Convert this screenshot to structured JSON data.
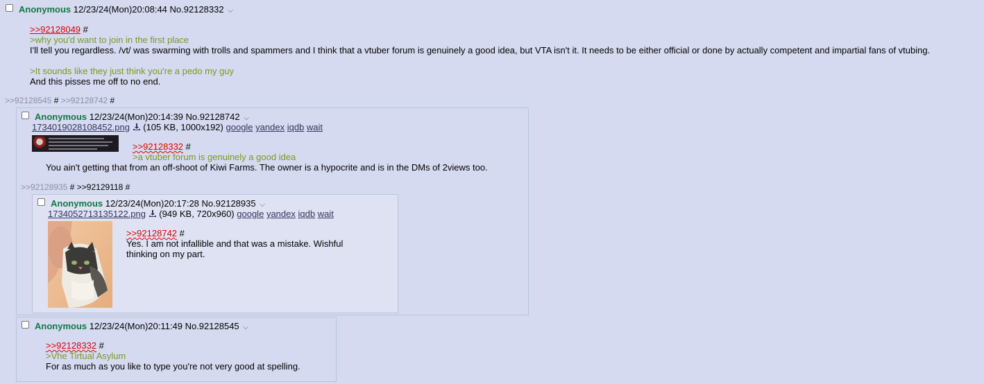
{
  "op": {
    "name": "Anonymous",
    "date": "12/23/24(Mon)20:08:44",
    "no": "No.92128332",
    "quote_link": ">>92128049",
    "greentext1": ">why you'd want to join in the first place",
    "text1": "I'll tell you regardless. /vt/ was swarming with trolls and spammers and I think that a vtuber forum is genuinely a good idea, but VTA isn't it. It needs to be either official or done by actually competent and impartial fans of vtubing.",
    "greentext2": ">It sounds like they just think you're a pedo my guy",
    "text2": "And this pisses me off to no end.",
    "backlinks": [
      ">>92128545",
      ">>92128742"
    ]
  },
  "reply1": {
    "name": "Anonymous",
    "date": "12/23/24(Mon)20:14:39",
    "no": "No.92128742",
    "filename": "1734019028108452.png",
    "fileinfo": "(105 KB, 1000x192)",
    "links": [
      "google",
      "yandex",
      "iqdb",
      "wait"
    ],
    "quote_link": ">>92128332",
    "greentext": ">a vtuber forum is genuinely a good idea",
    "text": "You ain't getting that from an off-shoot of Kiwi Farms. The owner is a hypocrite and is in the DMs of 2views too.",
    "backlinks": [
      ">>92128935",
      ">>92129118"
    ]
  },
  "reply2": {
    "name": "Anonymous",
    "date": "12/23/24(Mon)20:17:28",
    "no": "No.92128935",
    "filename": "1734052713135122.png",
    "fileinfo": "(949 KB, 720x960)",
    "links": [
      "google",
      "yandex",
      "iqdb",
      "wait"
    ],
    "quote_link": ">>92128742",
    "text_line1": "Yes. I am not infallible and that was a mistake. Wishful",
    "text_line2": "thinking on my part."
  },
  "reply3": {
    "name": "Anonymous",
    "date": "12/23/24(Mon)20:11:49",
    "no": "No.92128545",
    "quote_link": ">>92128332",
    "greentext": ">Vhe Tirtual Asylum",
    "text": "For as much as you like to type you're not very good at spelling."
  },
  "icons": {
    "menu": "chevron-down-icon",
    "download": "download-icon",
    "checkbox": "checkbox"
  },
  "colors": {
    "background": "#d6daf0",
    "name": "#117743",
    "quote": "#dd0000",
    "greentext": "#789922",
    "file_link": "#34345c"
  }
}
